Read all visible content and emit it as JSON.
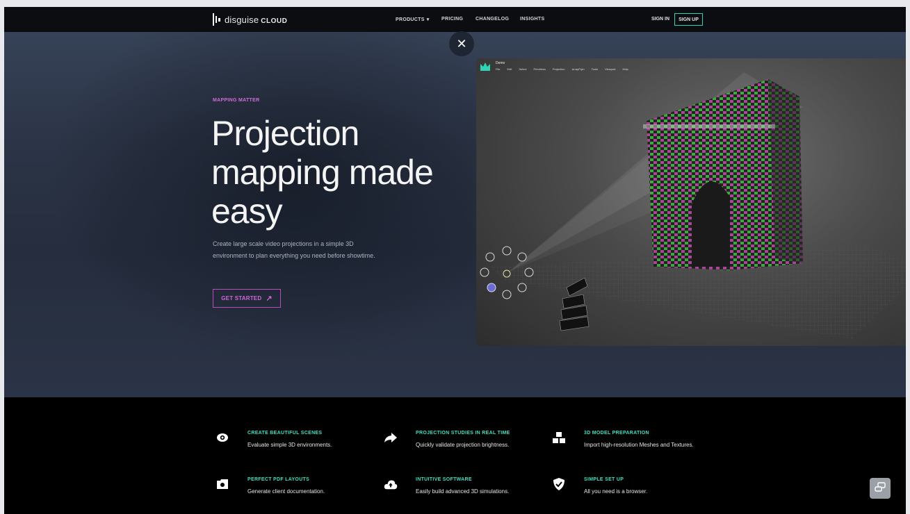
{
  "nav": {
    "logo_text": "disguise",
    "logo_bold": "CLOUD",
    "links": [
      {
        "label": "PRODUCTS"
      },
      {
        "label": "PRICING"
      },
      {
        "label": "CHANGELOG"
      },
      {
        "label": "INSIGHTS"
      }
    ],
    "sign_in": "SIGN IN",
    "sign_up": "SIGN UP"
  },
  "hero": {
    "eyebrow": "MAPPING MATTER",
    "headline": "Projection mapping made easy",
    "description": "Create large scale video projections in a simple 3D environment to plan everything you need before showtime.",
    "cta": "GET STARTED",
    "close_label": "✕"
  },
  "preview": {
    "app_title": "Demo",
    "menu": [
      "File",
      "Edit",
      "Select",
      "Primitives",
      "Projection",
      "ArrayFlyin",
      "Tools",
      "Viewport",
      "Help"
    ]
  },
  "features": [
    {
      "icon": "eye-icon",
      "title": "CREATE BEAUTIFUL SCENES",
      "desc": "Evaluate simple 3D environments."
    },
    {
      "icon": "share-arrow-icon",
      "title": "PROJECTION STUDIES IN REAL TIME",
      "desc": "Quickly validate projection brightness."
    },
    {
      "icon": "cubes-icon",
      "title": "3D MODEL PREPARATION",
      "desc": "Import high-resolution Meshes and Textures."
    },
    {
      "icon": "camera-folder-icon",
      "title": "PERFECT PDF LAYOUTS",
      "desc": "Generate client documentation."
    },
    {
      "icon": "cloud-upload-icon",
      "title": "INTUITIVE SOFTWARE",
      "desc": "Easily build advanced 3D simulations."
    },
    {
      "icon": "shield-check-icon",
      "title": "SIMPLE SET UP",
      "desc": "All you need is a browser."
    }
  ],
  "colors": {
    "accent_magenta": "#d068d6",
    "accent_teal": "#3fe0c0",
    "nav_bg": "#0b0d11"
  }
}
